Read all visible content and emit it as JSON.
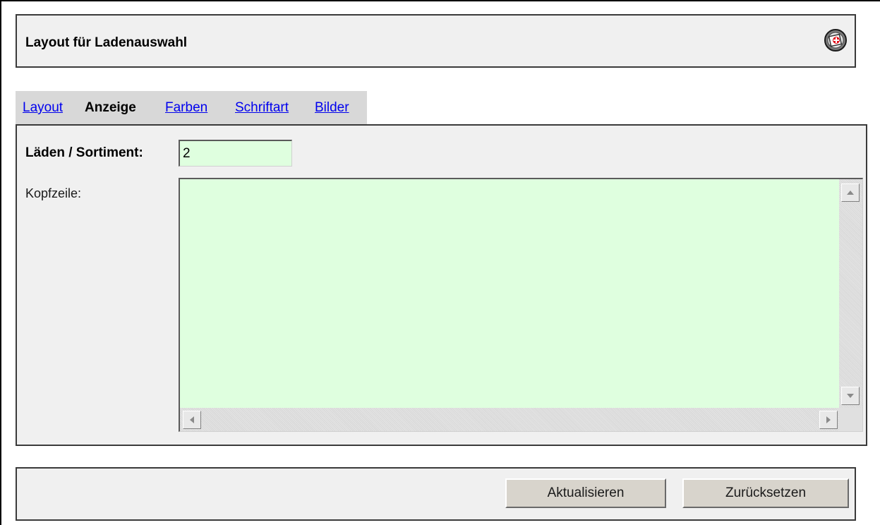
{
  "header": {
    "title": "Layout für Ladenauswahl",
    "help_icon": "help-icon"
  },
  "tabs": [
    {
      "label": "Layout",
      "active": false
    },
    {
      "label": "Anzeige",
      "active": true
    },
    {
      "label": "Farben",
      "active": false
    },
    {
      "label": "Schriftart",
      "active": false
    },
    {
      "label": "Bilder",
      "active": false
    }
  ],
  "form": {
    "stores_label": "Läden / Sortiment:",
    "stores_value": "2",
    "header_label": "Kopfzeile:",
    "header_value": ""
  },
  "footer": {
    "update_label": "Aktualisieren",
    "reset_label": "Zurücksetzen"
  },
  "colors": {
    "input_bg": "#dfffdf",
    "link": "#0000ee",
    "panel_bg": "#f0f0f0"
  }
}
